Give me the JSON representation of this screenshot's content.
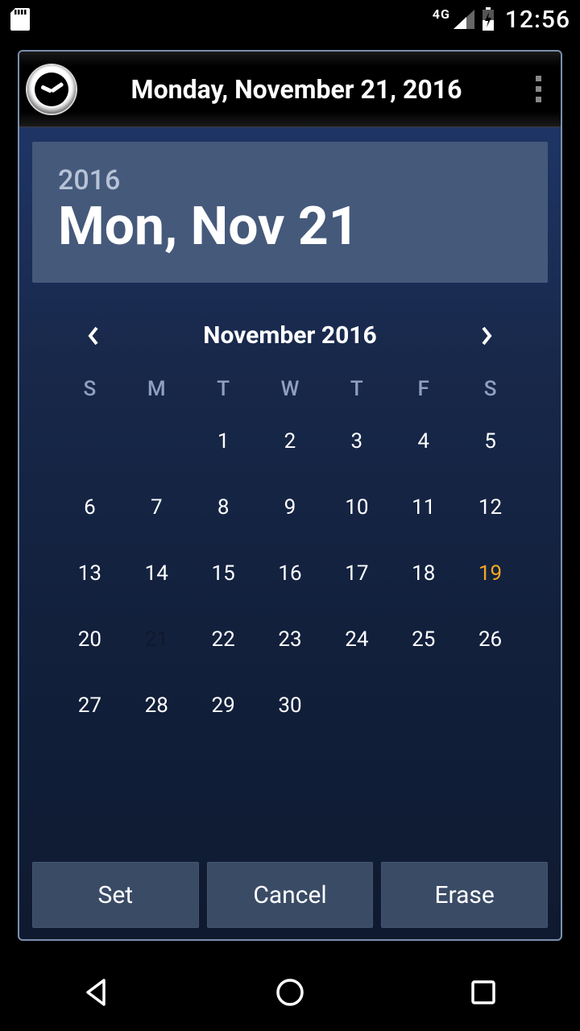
{
  "statusbar": {
    "network_label": "4G",
    "time": "12:56"
  },
  "dialog": {
    "title": "Monday, November 21, 2016",
    "header": {
      "year": "2016",
      "day": "Mon, Nov 21"
    },
    "month_nav": {
      "label": "November 2016"
    },
    "dow": [
      "S",
      "M",
      "T",
      "W",
      "T",
      "F",
      "S"
    ],
    "weeks": [
      [
        "",
        "",
        "1",
        "2",
        "3",
        "4",
        "5"
      ],
      [
        "6",
        "7",
        "8",
        "9",
        "10",
        "11",
        "12"
      ],
      [
        "13",
        "14",
        "15",
        "16",
        "17",
        "18",
        "19"
      ],
      [
        "20",
        "21",
        "22",
        "23",
        "24",
        "25",
        "26"
      ],
      [
        "27",
        "28",
        "29",
        "30",
        "",
        "",
        ""
      ]
    ],
    "today": "19",
    "selected": "21",
    "footer": {
      "set": "Set",
      "cancel": "Cancel",
      "erase": "Erase"
    }
  }
}
